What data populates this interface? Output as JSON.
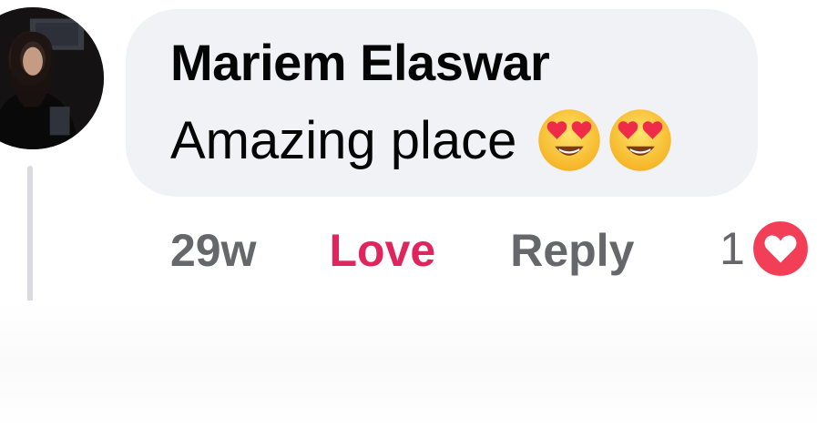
{
  "comment": {
    "author": "Mariem Elaswar",
    "text": "Amazing place",
    "emojis": [
      "heart-eyes-emoji",
      "heart-eyes-emoji"
    ]
  },
  "actions": {
    "time": "29w",
    "love_label": "Love",
    "reply_label": "Reply"
  },
  "reactions": {
    "count": "1",
    "type": "heart-reaction-icon"
  },
  "colors": {
    "bubble": "#f0f2f5",
    "love": "#e0245e",
    "secondary_text": "#65676b",
    "reaction_red": "#f33e58"
  }
}
